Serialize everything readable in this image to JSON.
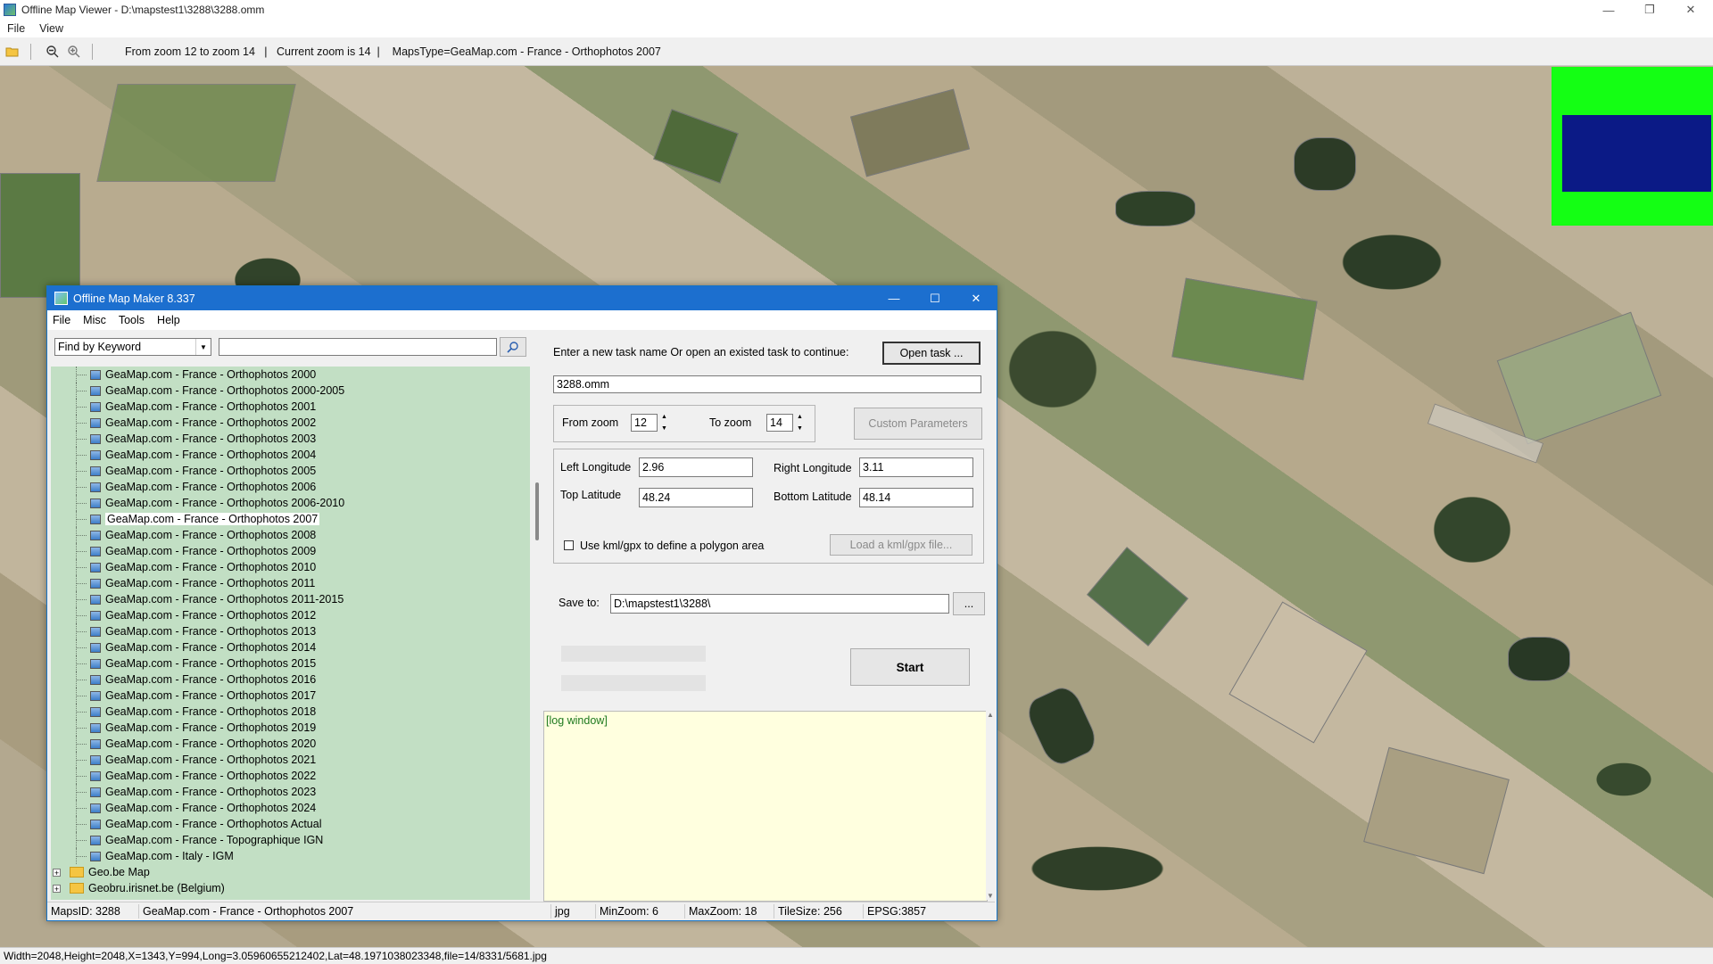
{
  "window": {
    "title": "Offline Map Viewer - D:\\mapstest1\\3288\\3288.omm",
    "menu": [
      "File",
      "View"
    ],
    "controls": {
      "minimize": "—",
      "restore": "❐",
      "close": "✕"
    }
  },
  "toolbar": {
    "info": "From zoom 12 to zoom 14   |   Current zoom is 14  |    MapsType=GeaMap.com - France - Orthophotos 2007"
  },
  "status_bar": "Width=2048,Height=2048,X=1343,Y=994,Long=3.05960655212402,Lat=48.1971038023348,file=14/8331/5681.jpg",
  "dialog": {
    "title": "Offline Map Maker 8.337",
    "menu": [
      "File",
      "Misc",
      "Tools",
      "Help"
    ],
    "controls": {
      "minimize": "—",
      "maximize": "☐",
      "close": "✕"
    },
    "search": {
      "mode": "Find by Keyword",
      "value": ""
    },
    "tree": {
      "items": [
        "GeaMap.com - France - Orthophotos 2000",
        "GeaMap.com - France - Orthophotos 2000-2005",
        "GeaMap.com - France - Orthophotos 2001",
        "GeaMap.com - France - Orthophotos 2002",
        "GeaMap.com - France - Orthophotos 2003",
        "GeaMap.com - France - Orthophotos 2004",
        "GeaMap.com - France - Orthophotos 2005",
        "GeaMap.com - France - Orthophotos 2006",
        "GeaMap.com - France - Orthophotos 2006-2010",
        "GeaMap.com - France - Orthophotos 2007",
        "GeaMap.com - France - Orthophotos 2008",
        "GeaMap.com - France - Orthophotos 2009",
        "GeaMap.com - France - Orthophotos 2010",
        "GeaMap.com - France - Orthophotos 2011",
        "GeaMap.com - France - Orthophotos 2011-2015",
        "GeaMap.com - France - Orthophotos 2012",
        "GeaMap.com - France - Orthophotos 2013",
        "GeaMap.com - France - Orthophotos 2014",
        "GeaMap.com - France - Orthophotos 2015",
        "GeaMap.com - France - Orthophotos 2016",
        "GeaMap.com - France - Orthophotos 2017",
        "GeaMap.com - France - Orthophotos 2018",
        "GeaMap.com - France - Orthophotos 2019",
        "GeaMap.com - France - Orthophotos 2020",
        "GeaMap.com - France - Orthophotos 2021",
        "GeaMap.com - France - Orthophotos 2022",
        "GeaMap.com - France - Orthophotos 2023",
        "GeaMap.com - France - Orthophotos 2024",
        "GeaMap.com - France - Orthophotos Actual",
        "GeaMap.com - France - Topographique IGN",
        "GeaMap.com - Italy - IGM"
      ],
      "selected": "GeaMap.com - France - Orthophotos 2007",
      "folders": [
        "Geo.be Map",
        "Geobru.irisnet.be (Belgium)"
      ]
    },
    "task_prompt": "Enter a new task name Or open an existed task to continue:",
    "open_task": "Open task ...",
    "task_name": "3288.omm",
    "from_zoom_label": "From zoom",
    "from_zoom": "12",
    "to_zoom_label": "To zoom",
    "to_zoom": "14",
    "custom_params": "Custom Parameters",
    "left_lon_label": "Left Longitude",
    "left_lon": "2.96",
    "right_lon_label": "Right Longitude",
    "right_lon": "3.11",
    "top_lat_label": "Top Latitude",
    "top_lat": "48.24",
    "bottom_lat_label": "Bottom Latitude",
    "bottom_lat": "48.14",
    "use_kml_label": "Use kml/gpx to define a polygon area",
    "load_kml": "Load a kml/gpx file...",
    "save_to_label": "Save to:",
    "save_to": "D:\\mapstest1\\3288\\",
    "browse": "...",
    "start": "Start",
    "log": "[log window]",
    "status": {
      "maps_id": "MapsID: 3288",
      "maps_name": "GeaMap.com - France - Orthophotos 2007",
      "format": "jpg",
      "min_zoom": "MinZoom: 6",
      "max_zoom": "MaxZoom: 18",
      "tile_size": "TileSize: 256",
      "epsg": "EPSG:3857"
    }
  }
}
